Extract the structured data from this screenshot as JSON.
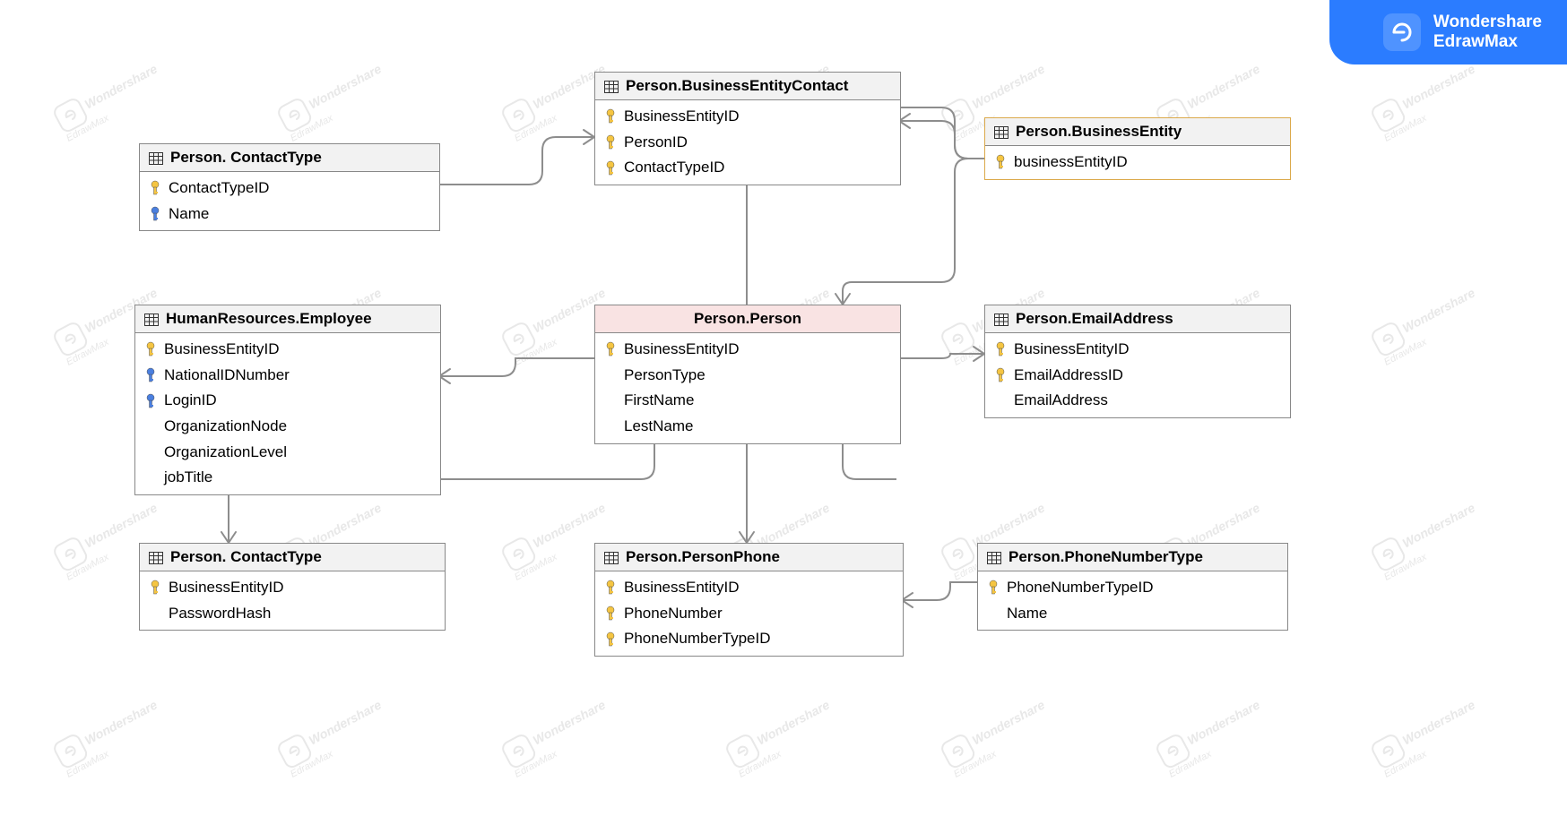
{
  "brand": {
    "line1": "Wondershare",
    "line2": "EdrawMax"
  },
  "watermark": {
    "big": "Wondershare",
    "small": "EdrawMax"
  },
  "entities": {
    "bec": {
      "title": "Person.BusinessEntityContact",
      "cols": [
        {
          "k": "pk",
          "n": "BusinessEntityID"
        },
        {
          "k": "pk",
          "n": "PersonID"
        },
        {
          "k": "pk",
          "n": "ContactTypeID"
        }
      ]
    },
    "ct1": {
      "title": "Person. ContactType",
      "cols": [
        {
          "k": "pk",
          "n": "ContactTypeID"
        },
        {
          "k": "idx",
          "n": "Name"
        }
      ]
    },
    "be": {
      "title": "Person.BusinessEntity",
      "cols": [
        {
          "k": "pk",
          "n": "businessEntityID"
        }
      ]
    },
    "emp": {
      "title": "HumanResources.Employee",
      "cols": [
        {
          "k": "pk",
          "n": "BusinessEntityID"
        },
        {
          "k": "idx",
          "n": "NationalIDNumber"
        },
        {
          "k": "idx",
          "n": "LoginID"
        },
        {
          "k": "",
          "n": "OrganizationNode"
        },
        {
          "k": "",
          "n": "OrganizationLevel"
        },
        {
          "k": "",
          "n": "jobTitle"
        }
      ]
    },
    "person": {
      "title": "Person.Person",
      "cols": [
        {
          "k": "pk",
          "n": "BusinessEntityID"
        },
        {
          "k": "",
          "n": "PersonType"
        },
        {
          "k": "",
          "n": "FirstName"
        },
        {
          "k": "",
          "n": "LestName"
        }
      ]
    },
    "email": {
      "title": "Person.EmailAddress",
      "cols": [
        {
          "k": "pk",
          "n": "BusinessEntityID"
        },
        {
          "k": "pk",
          "n": "EmailAddressID"
        },
        {
          "k": "",
          "n": "EmailAddress"
        }
      ]
    },
    "ct2": {
      "title": "Person. ContactType",
      "cols": [
        {
          "k": "pk",
          "n": "BusinessEntityID"
        },
        {
          "k": "",
          "n": "PasswordHash"
        }
      ]
    },
    "phone": {
      "title": "Person.PersonPhone",
      "cols": [
        {
          "k": "pk",
          "n": "BusinessEntityID"
        },
        {
          "k": "pk",
          "n": "PhoneNumber"
        },
        {
          "k": "pk",
          "n": "PhoneNumberTypeID"
        }
      ]
    },
    "pnt": {
      "title": "Person.PhoneNumberType",
      "cols": [
        {
          "k": "pk",
          "n": "PhoneNumberTypeID"
        },
        {
          "k": "",
          "n": "Name"
        }
      ]
    }
  }
}
